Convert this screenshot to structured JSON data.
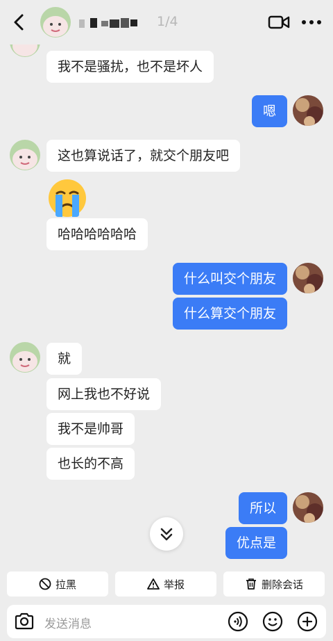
{
  "header": {
    "counter": "1/4",
    "icons": [
      "back-icon",
      "video-call-icon",
      "more-icon"
    ]
  },
  "messages": [
    {
      "side": "in",
      "text": "我不是骚扰，也不是坏人"
    },
    {
      "side": "out",
      "text": "嗯"
    },
    {
      "side": "in",
      "text": "这也算说话了，就交个朋友吧"
    },
    {
      "side": "in",
      "emoji": "crying-face"
    },
    {
      "side": "in",
      "text": "哈哈哈哈哈哈"
    },
    {
      "side": "out",
      "text": "什么叫交个朋友"
    },
    {
      "side": "out",
      "text": "什么算交个朋友"
    },
    {
      "side": "in",
      "text": "就"
    },
    {
      "side": "in",
      "text": "网上我也不好说"
    },
    {
      "side": "in",
      "text": "我不是帅哥"
    },
    {
      "side": "in",
      "text": "也长的不高"
    },
    {
      "side": "out",
      "text": "所以"
    },
    {
      "side": "out",
      "text": "优点是"
    }
  ],
  "actions": {
    "block": "拉黑",
    "report": "举报",
    "delete": "删除会话"
  },
  "input": {
    "placeholder": "发送消息"
  },
  "colors": {
    "background": "#ededed",
    "outgoing_bubble": "#3b7cf6",
    "incoming_bubble": "#ffffff"
  }
}
